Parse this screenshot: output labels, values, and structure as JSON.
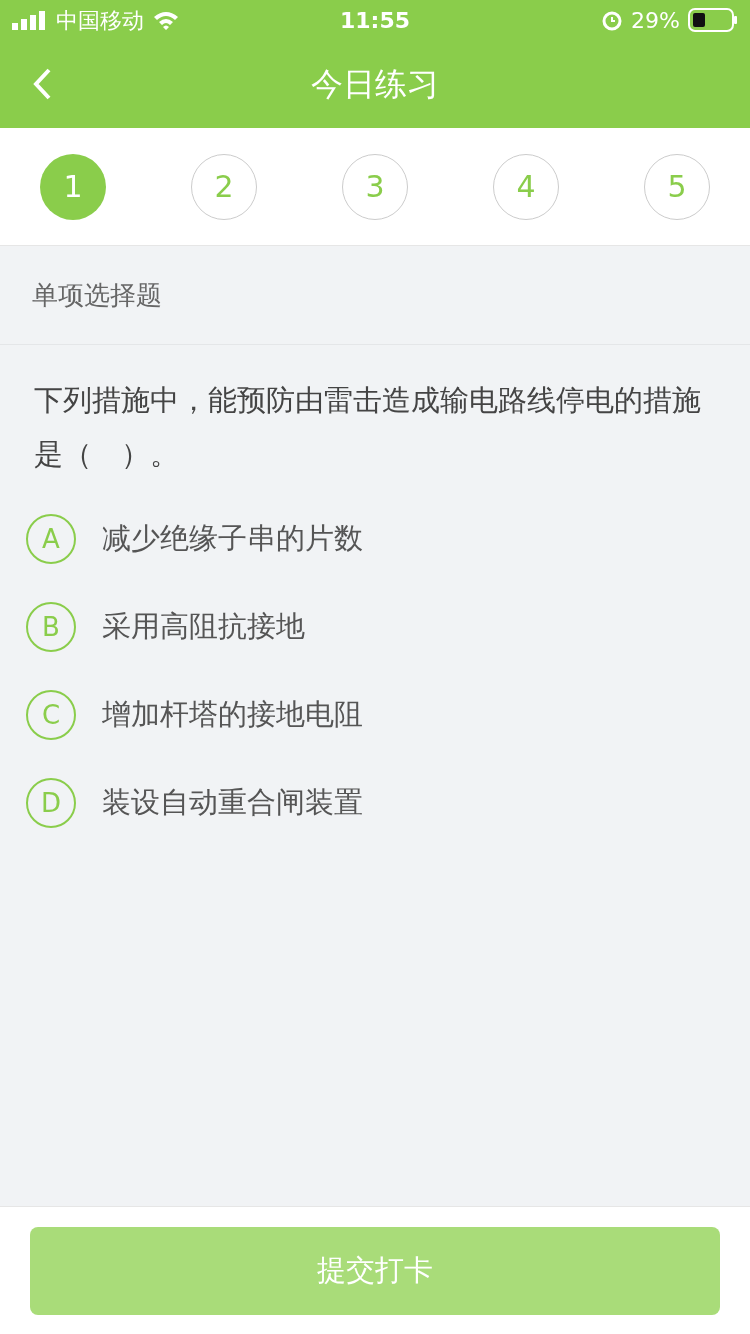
{
  "status_bar": {
    "carrier": "中国移动",
    "time": "11:55",
    "battery": "29%"
  },
  "nav": {
    "title": "今日练习"
  },
  "steps": [
    {
      "label": "1",
      "selected": true
    },
    {
      "label": "2",
      "selected": false
    },
    {
      "label": "3",
      "selected": false
    },
    {
      "label": "4",
      "selected": false
    },
    {
      "label": "5",
      "selected": false
    }
  ],
  "section_title": "单项选择题",
  "question": "下列措施中，能预防由雷击造成输电路线停电的措施是（　）。",
  "options": [
    {
      "letter": "A",
      "text": "减少绝缘子串的片数",
      "selected": false
    },
    {
      "letter": "B",
      "text": "采用高阻抗接地",
      "selected": false
    },
    {
      "letter": "C",
      "text": "增加杆塔的接地电阻",
      "selected": false
    },
    {
      "letter": "D",
      "text": "装设自动重合闸装置",
      "selected": false
    }
  ],
  "submit_button": {
    "label": "提交打卡",
    "disabled": true
  }
}
